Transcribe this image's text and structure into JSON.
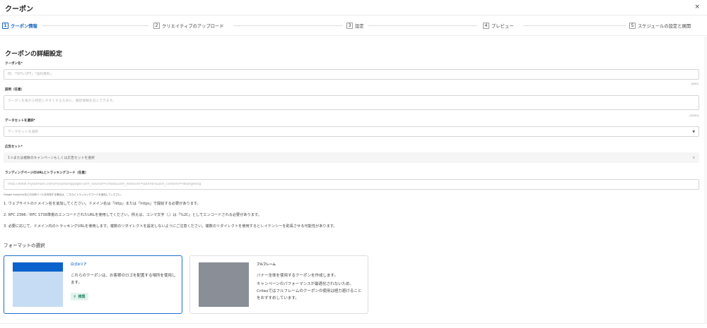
{
  "header": {
    "title": "クーポン",
    "close": "×"
  },
  "steps": [
    {
      "num": "1",
      "label": "クーポン情報",
      "active": true
    },
    {
      "num": "2",
      "label": "クリエイティブのアップロード",
      "active": false
    },
    {
      "num": "3",
      "label": "設定",
      "active": false
    },
    {
      "num": "4",
      "label": "プレビュー",
      "active": false
    },
    {
      "num": "5",
      "label": "スケジュールの設定と展開",
      "active": false
    }
  ],
  "form": {
    "section_title": "クーポンの詳細設定",
    "name": {
      "label": "クーポン名*",
      "placeholder": "例：「50% OFF」「送料無料」",
      "counter": "(0/50)"
    },
    "description": {
      "label": "説明（任意）",
      "placeholder": "クーポンを後から特定しやすくするために、補足情報を記入できます。",
      "counter": "(0/250)"
    },
    "dataset": {
      "label": "データセットを選択*",
      "placeholder": "データセットを選択",
      "icon": "caret-down"
    },
    "adset": {
      "label": "広告セット*",
      "value": "1つまたは複数のキャンペーンもしくは広告セットを選択",
      "icon": "caret-down"
    },
    "landing": {
      "label": "ランディングページのURLとトラッキングコード（任意）",
      "placeholder": "http://www.mydomain.com/mylandingpage?utm_source=criteo&utm_medium=banner&utm_content=retargeting",
      "help": "Google Analyticsなどの分析ツールを利用する場合は、こちらにトラッキングコードを追加してください。"
    },
    "notes": [
      "1. ウェブサイトのドメイン名を追加してください。ドメイン名は「http」または「https」で開始する必要があります。",
      "2. RFC 2396／RFC 1738準拠のエンコードされたURLを使用してください。例えば、コンマ文字（,）は「%2C」としてエンコードされる必要があります。",
      "3. 必要に応じて、ドメイン内のトラッキングURLを使用します。複数のリダイレクトを設定しないようにご注意ください。複数のリダイレクトを使用するとレイテンシーを助長させる可能性があります。"
    ]
  },
  "format": {
    "title": "フォーマットの選択",
    "options": [
      {
        "name": "ロゴエリア",
        "desc": "これらのクーポンは、お客様のロゴを配置する場所を使用します。",
        "badge": "推奨",
        "selected": true,
        "colors": {
          "bar": "#0b62cc",
          "area": "#c5dcf4"
        }
      },
      {
        "name": "フルフレーム",
        "desc1": "バナー全体を使用するクーポンを作成します。",
        "desc2": "キャンペーンのパフォーマンスが最適化されないため、Criteoではフルフレームのクーポンの使用は極力避けることをおすすめしています。",
        "selected": false,
        "colors": {
          "area": "#8a8e96"
        }
      }
    ]
  },
  "colors": {
    "accent": "#1565c0",
    "recommended": "#1b7d5e"
  }
}
